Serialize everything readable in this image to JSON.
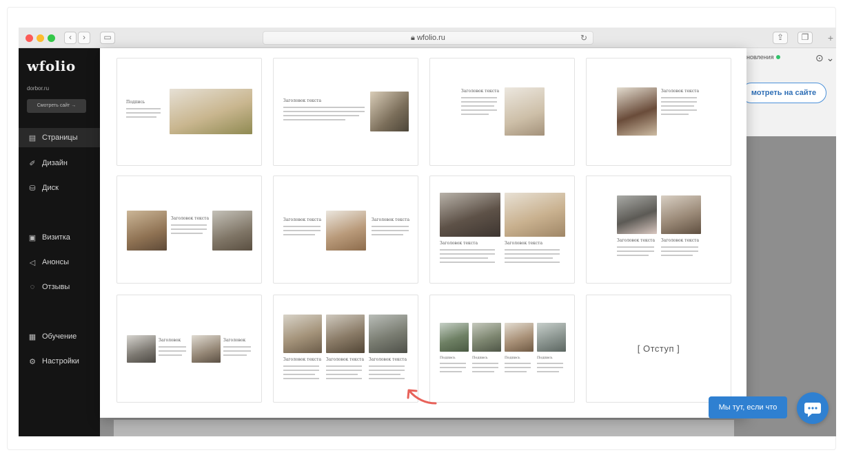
{
  "browser": {
    "url": "wfolio.ru",
    "lock_icon": "lock-icon",
    "reload_icon": "reload-icon",
    "back_icon": "chevron-left-icon",
    "forward_icon": "chevron-right-icon",
    "share_icon": "share-icon",
    "tabs_icon": "tabs-icon"
  },
  "sidebar": {
    "logo": "wfolio",
    "domain": "dorbor.ru",
    "view_site": "Смотреть сайт →",
    "items": [
      {
        "label": "Страницы",
        "icon": "page-icon",
        "active": true
      },
      {
        "label": "Дизайн",
        "icon": "brush-icon",
        "active": false
      },
      {
        "label": "Диск",
        "icon": "disk-icon",
        "active": false
      },
      {
        "label": "Визитка",
        "icon": "card-icon",
        "active": false
      },
      {
        "label": "Анонсы",
        "icon": "megaphone-icon",
        "active": false
      },
      {
        "label": "Отзывы",
        "icon": "chat-icon",
        "active": false
      },
      {
        "label": "Обучение",
        "icon": "book-icon",
        "active": false
      },
      {
        "label": "Настройки",
        "icon": "gear-icon",
        "active": false
      }
    ]
  },
  "header": {
    "updates_label": "новления",
    "view_button": "мотреть на сайте"
  },
  "modal": {
    "block_text": {
      "heading_short": "Заголовок",
      "heading": "Заголовок текста",
      "caption": "Подпись"
    },
    "spacer_label": "[ Отступ ]"
  },
  "chat": {
    "badge": "Мы тут, если что",
    "icon": "chat-bubble-icon"
  },
  "colors": {
    "accent": "#2f80d1",
    "sidebar_bg": "#141414",
    "status_green": "#31c36b",
    "arrow": "#e8625a"
  }
}
